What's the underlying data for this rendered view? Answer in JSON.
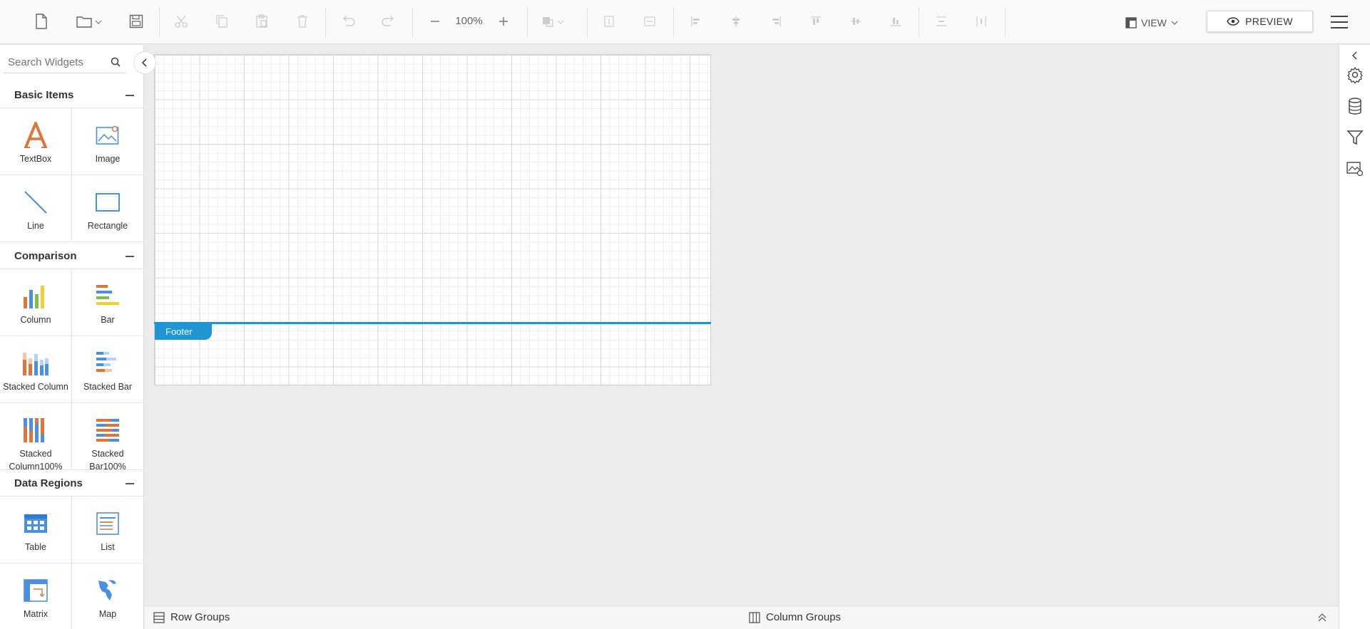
{
  "toolbar": {
    "zoom_level": "100%",
    "view_label": "VIEW",
    "preview_label": "PREVIEW"
  },
  "left_panel": {
    "search_placeholder": "Search Widgets",
    "sections": [
      {
        "title": "Basic Items",
        "items": [
          {
            "label": "TextBox",
            "icon": "textbox-icon"
          },
          {
            "label": "Image",
            "icon": "image-icon"
          },
          {
            "label": "Line",
            "icon": "line-icon"
          },
          {
            "label": "Rectangle",
            "icon": "rectangle-icon"
          }
        ]
      },
      {
        "title": "Comparison",
        "items": [
          {
            "label": "Column",
            "icon": "column-chart-icon"
          },
          {
            "label": "Bar",
            "icon": "bar-chart-icon"
          },
          {
            "label": "Stacked Column",
            "icon": "stacked-column-icon"
          },
          {
            "label": "Stacked Bar",
            "icon": "stacked-bar-icon"
          },
          {
            "label": "Stacked Column100%",
            "icon": "stacked-column100-icon"
          },
          {
            "label": "Stacked Bar100%",
            "icon": "stacked-bar100-icon"
          }
        ]
      },
      {
        "title": "Data Regions",
        "items": [
          {
            "label": "Table",
            "icon": "table-icon"
          },
          {
            "label": "List",
            "icon": "list-icon"
          },
          {
            "label": "Matrix",
            "icon": "matrix-icon"
          },
          {
            "label": "Map",
            "icon": "map-icon"
          }
        ]
      }
    ]
  },
  "canvas": {
    "footer_label": "Footer"
  },
  "bottom_bar": {
    "row_groups_label": "Row Groups",
    "column_groups_label": "Column Groups"
  },
  "colors": {
    "accent": "#1f96d3",
    "orange": "#e2733a",
    "blue": "#4a90e2",
    "yellow": "#f2d12e",
    "green": "#7cc04a"
  }
}
